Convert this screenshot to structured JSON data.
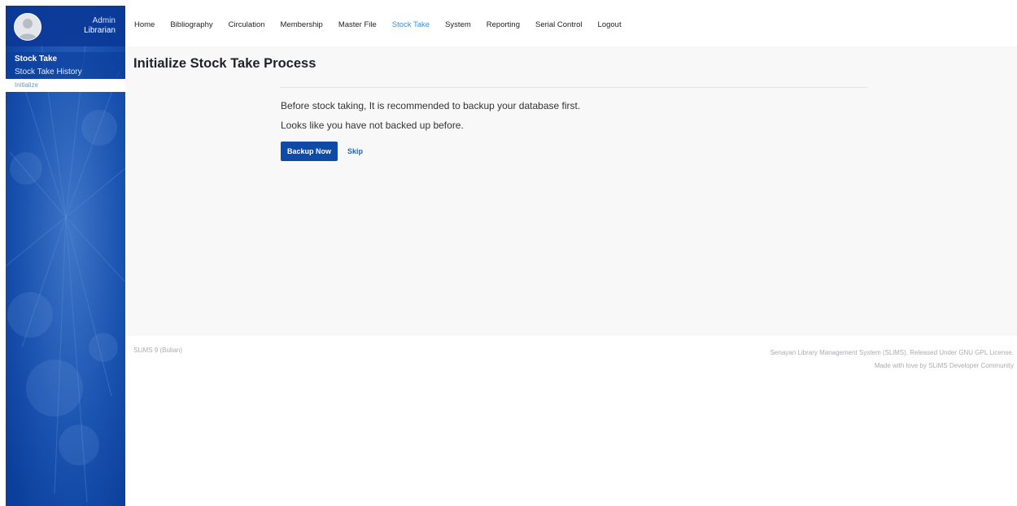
{
  "profile": {
    "name": "Admin",
    "role": "Librarian"
  },
  "sidebar": {
    "heading": "Stock Take",
    "items": [
      {
        "label": "Stock Take History"
      },
      {
        "label": "Initialize"
      }
    ]
  },
  "nav": {
    "items": [
      {
        "label": "Home"
      },
      {
        "label": "Bibliography"
      },
      {
        "label": "Circulation"
      },
      {
        "label": "Membership"
      },
      {
        "label": "Master File"
      },
      {
        "label": "Stock Take"
      },
      {
        "label": "System"
      },
      {
        "label": "Reporting"
      },
      {
        "label": "Serial Control"
      },
      {
        "label": "Logout"
      }
    ],
    "active": "Stock Take"
  },
  "main": {
    "title": "Initialize Stock Take Process",
    "message_line1": "Before stock taking, It is recommended to backup your database first.",
    "message_line2": "Looks like you have not backed up before.",
    "backup_button": "Backup Now",
    "skip_link": "Skip"
  },
  "footer": {
    "version": "SLiMS 9 (Bulian)",
    "line1": "Senayan Library Management System (SLiMS). Released Under GNU GPL License.",
    "line2": "Made with love by SLiMS Developer Community"
  },
  "colors": {
    "sidebar_blue": "#0f47a6",
    "active_nav": "#3c8fd6",
    "button_blue": "#0e4aa6"
  },
  "icons": {
    "avatar": "user-avatar-icon"
  }
}
